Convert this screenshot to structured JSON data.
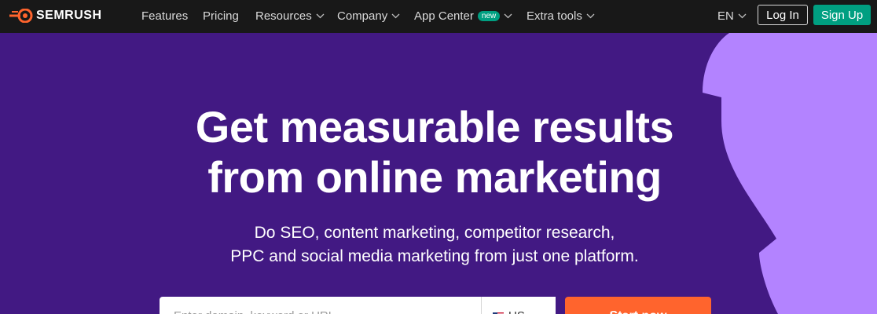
{
  "header": {
    "brand": "SEMRUSH",
    "nav": [
      {
        "label": "Features"
      },
      {
        "label": "Pricing"
      },
      {
        "label": "Resources"
      },
      {
        "label": "Company"
      },
      {
        "label": "App Center",
        "badge": "new"
      },
      {
        "label": "Extra tools"
      }
    ],
    "language": "EN",
    "login_label": "Log In",
    "signup_label": "Sign Up"
  },
  "hero": {
    "title_line1": "Get measurable results",
    "title_line2": "from online marketing",
    "subtitle_line1": "Do SEO, content marketing, competitor research,",
    "subtitle_line2": "PPC and social media marketing from just one platform.",
    "search_placeholder": "Enter domain, keyword or URL",
    "database": "US",
    "start_label": "Start now"
  },
  "colors": {
    "topbar": "#181818",
    "hero_bg": "#421983",
    "blob": "#b383ff",
    "brand_orange": "#ff642d",
    "green": "#009f81"
  },
  "icons": [
    "semrush-logo-icon",
    "chevron-down-icon",
    "us-flag-icon"
  ]
}
